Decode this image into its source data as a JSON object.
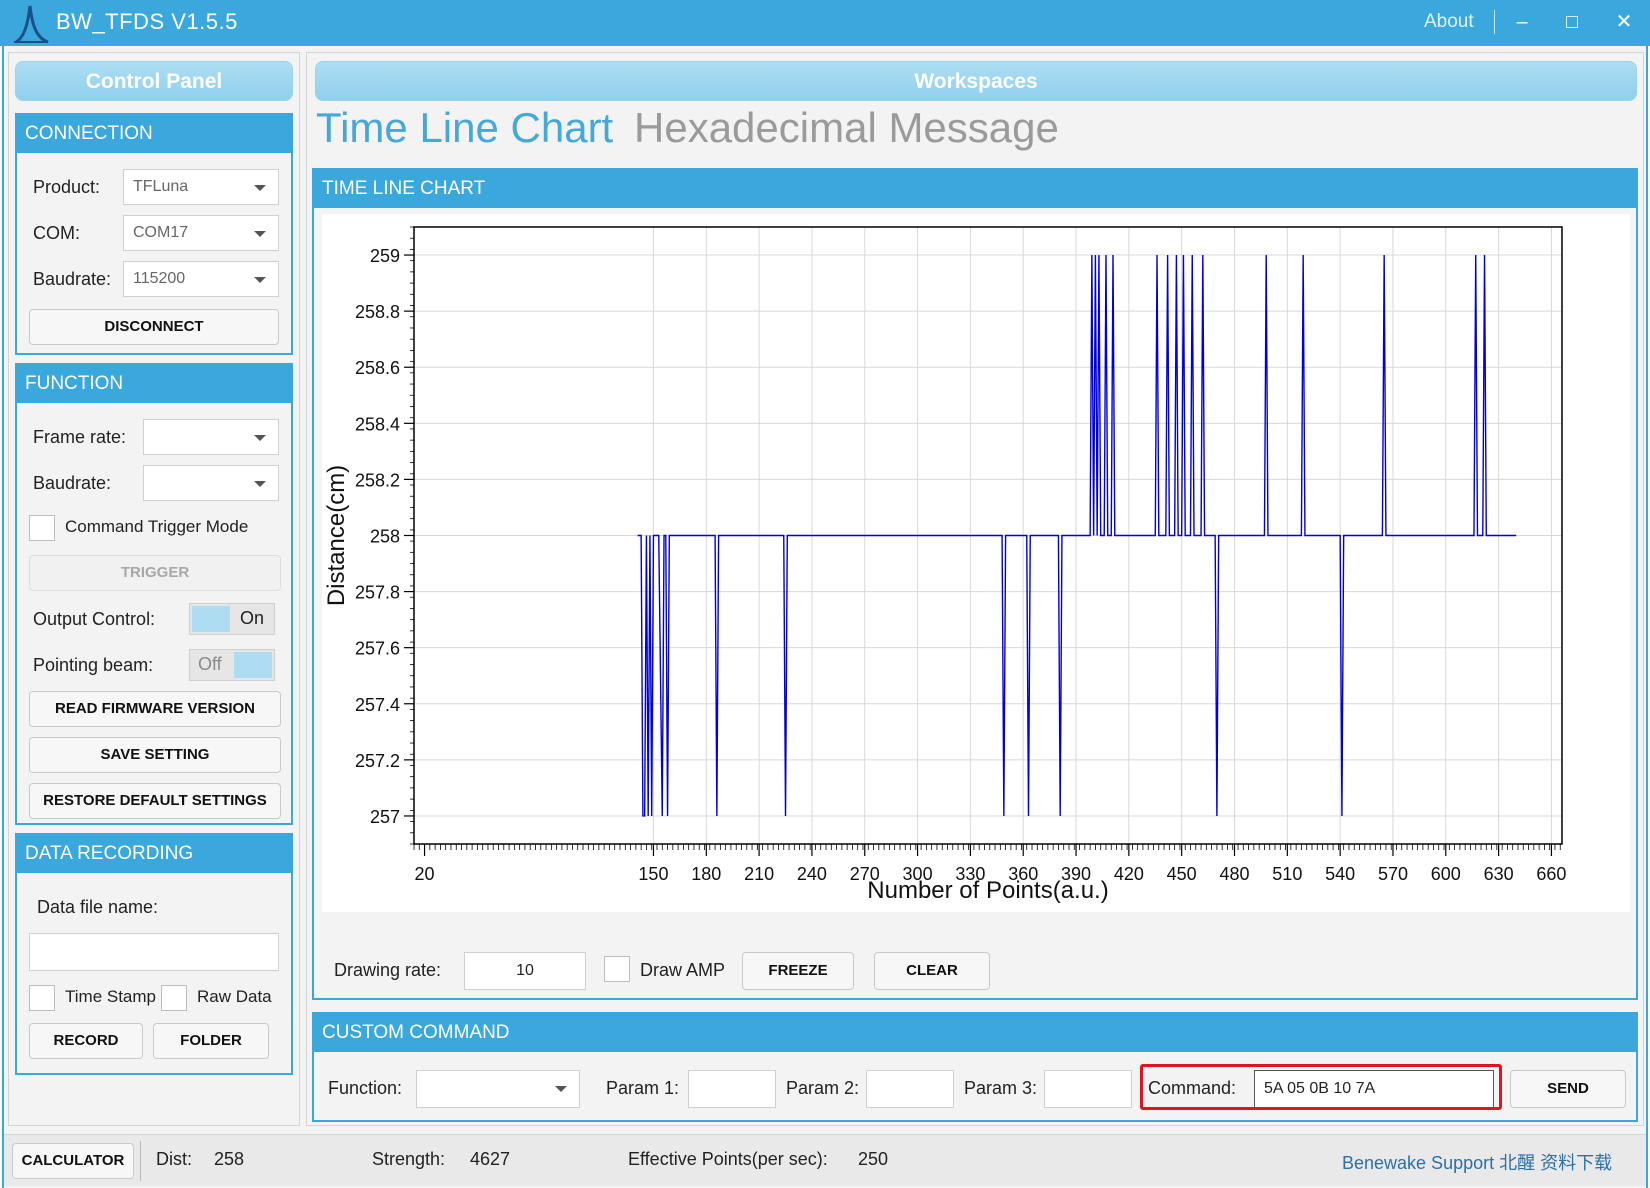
{
  "window": {
    "title": "BW_TFDS V1.5.5",
    "about": "About",
    "minimize": "–",
    "maximize": "□",
    "close": "✕"
  },
  "control_panel": {
    "title": "Control Panel",
    "connection": {
      "header": "CONNECTION",
      "product_label": "Product:",
      "product_value": "TFLuna",
      "com_label": "COM:",
      "com_value": "COM17",
      "baud_label": "Baudrate:",
      "baud_value": "115200",
      "disconnect": "DISCONNECT"
    },
    "function": {
      "header": "FUNCTION",
      "frame_rate_label": "Frame rate:",
      "frame_rate_value": "",
      "baud_label": "Baudrate:",
      "baud_value": "",
      "command_trigger_label": "Command Trigger Mode",
      "trigger": "TRIGGER",
      "output_control_label": "Output Control:",
      "output_control_state": "On",
      "pointing_beam_label": "Pointing beam:",
      "pointing_beam_state": "Off",
      "read_firmware": "READ FIRMWARE VERSION",
      "save_setting": "SAVE SETTING",
      "restore_default": "RESTORE DEFAULT SETTINGS"
    },
    "data_recording": {
      "header": "DATA RECORDING",
      "file_name_label": "Data file name:",
      "file_name_value": "",
      "time_stamp": "Time Stamp",
      "raw_data": "Raw Data",
      "record": "RECORD",
      "folder": "FOLDER"
    }
  },
  "workspaces": {
    "title": "Workspaces",
    "tabs": [
      {
        "label": "Time Line Chart",
        "active": true
      },
      {
        "label": "Hexadecimal Message",
        "active": false
      }
    ],
    "chart_group_header": "TIME LINE CHART",
    "drawing_rate_label": "Drawing rate:",
    "drawing_rate_value": "10",
    "draw_amp_label": "Draw AMP",
    "freeze": "FREEZE",
    "clear": "CLEAR"
  },
  "custom_command": {
    "header": "CUSTOM COMMAND",
    "function_label": "Function:",
    "function_value": "",
    "param1_label": "Param 1:",
    "param1_value": "",
    "param2_label": "Param 2:",
    "param2_value": "",
    "param3_label": "Param 3:",
    "param3_value": "",
    "command_label": "Command:",
    "command_value": "5A 05 0B 10 7A",
    "send": "SEND"
  },
  "status_bar": {
    "calculator": "CALCULATOR",
    "dist_label": "Dist:",
    "dist_value": "258",
    "strength_label": "Strength:",
    "strength_value": "4627",
    "effective_label": "Effective Points(per sec):",
    "effective_value": "250",
    "support_link": "Benewake Support 北醒 资料下载"
  },
  "colors": {
    "accent": "#3aa8dc",
    "line": "#0000dd",
    "highlight_box": "#e0141e"
  },
  "chart_data": {
    "type": "line",
    "xlabel": "Number of Points(a.u.)",
    "ylabel": "Distance(cm)",
    "xlim": [
      14,
      666
    ],
    "ylim": [
      256.9,
      259.1
    ],
    "xticks": [
      20,
      150,
      180,
      210,
      240,
      270,
      300,
      330,
      360,
      390,
      420,
      450,
      480,
      510,
      540,
      570,
      600,
      630,
      660
    ],
    "yticks": [
      257,
      257.2,
      257.4,
      257.6,
      257.8,
      258,
      258.2,
      258.4,
      258.6,
      258.8,
      259
    ],
    "grid": true,
    "series": [
      {
        "x": [
          141,
          143,
          144,
          145,
          146,
          147,
          148,
          149,
          150,
          151,
          152,
          153,
          155,
          156,
          157,
          158,
          159,
          185,
          186,
          187,
          224,
          225,
          226,
          348,
          349,
          350,
          362,
          363,
          364,
          380,
          381,
          382,
          398,
          399,
          400,
          401,
          402,
          403,
          404,
          406,
          407,
          408,
          410,
          411,
          412,
          435,
          436,
          437,
          441,
          442,
          443,
          446,
          447,
          448,
          450,
          451,
          452,
          455,
          456,
          457,
          461,
          462,
          463,
          469,
          470,
          471,
          497,
          498,
          499,
          518,
          519,
          520,
          540,
          541,
          542,
          564,
          565,
          566,
          616,
          617,
          618,
          621,
          622,
          623,
          640
        ],
        "y": [
          258,
          258,
          257,
          257,
          258,
          257,
          258,
          257,
          258,
          258,
          258,
          258,
          257,
          258,
          258,
          257,
          258,
          258,
          257,
          258,
          258,
          257,
          258,
          258,
          257,
          258,
          258,
          257,
          258,
          258,
          257,
          258,
          258,
          259,
          258,
          259,
          258,
          259,
          258,
          258,
          259,
          258,
          258,
          259,
          258,
          258,
          259,
          258,
          258,
          259,
          258,
          258,
          259,
          258,
          258,
          259,
          258,
          258,
          259,
          258,
          258,
          259,
          258,
          258,
          257,
          258,
          258,
          259,
          258,
          258,
          259,
          258,
          258,
          257,
          258,
          258,
          259,
          258,
          258,
          259,
          258,
          258,
          259,
          258,
          258
        ]
      }
    ]
  }
}
